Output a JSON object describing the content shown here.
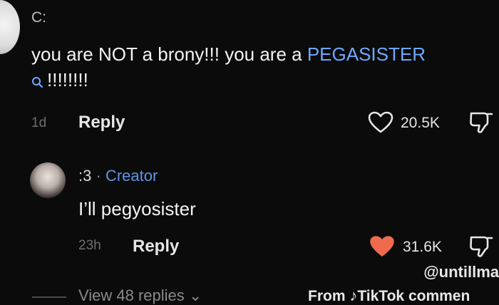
{
  "comment": {
    "username": "C:",
    "text_part1": "you are NOT a brony!!! you are a ",
    "highlight": "PEGASISTER",
    "text_part2": "!!!!!!!!",
    "time": "1d",
    "reply_label": "Reply",
    "likes": "20.5K"
  },
  "reply": {
    "username": ":3",
    "separator": "·",
    "badge": "Creator",
    "text": "I’ll pegyosister",
    "time": "23h",
    "reply_label": "Reply",
    "likes": "31.6K"
  },
  "view_replies": "View 48 replies",
  "watermark": {
    "handle": "@untillma",
    "from": "From",
    "logo": "TikTok",
    "suffix": "commen"
  },
  "colors": {
    "background": "#0b0b0b",
    "highlight": "#6fa8ff",
    "creator": "#5c97e6",
    "liked_heart": "#ee6b4d"
  }
}
